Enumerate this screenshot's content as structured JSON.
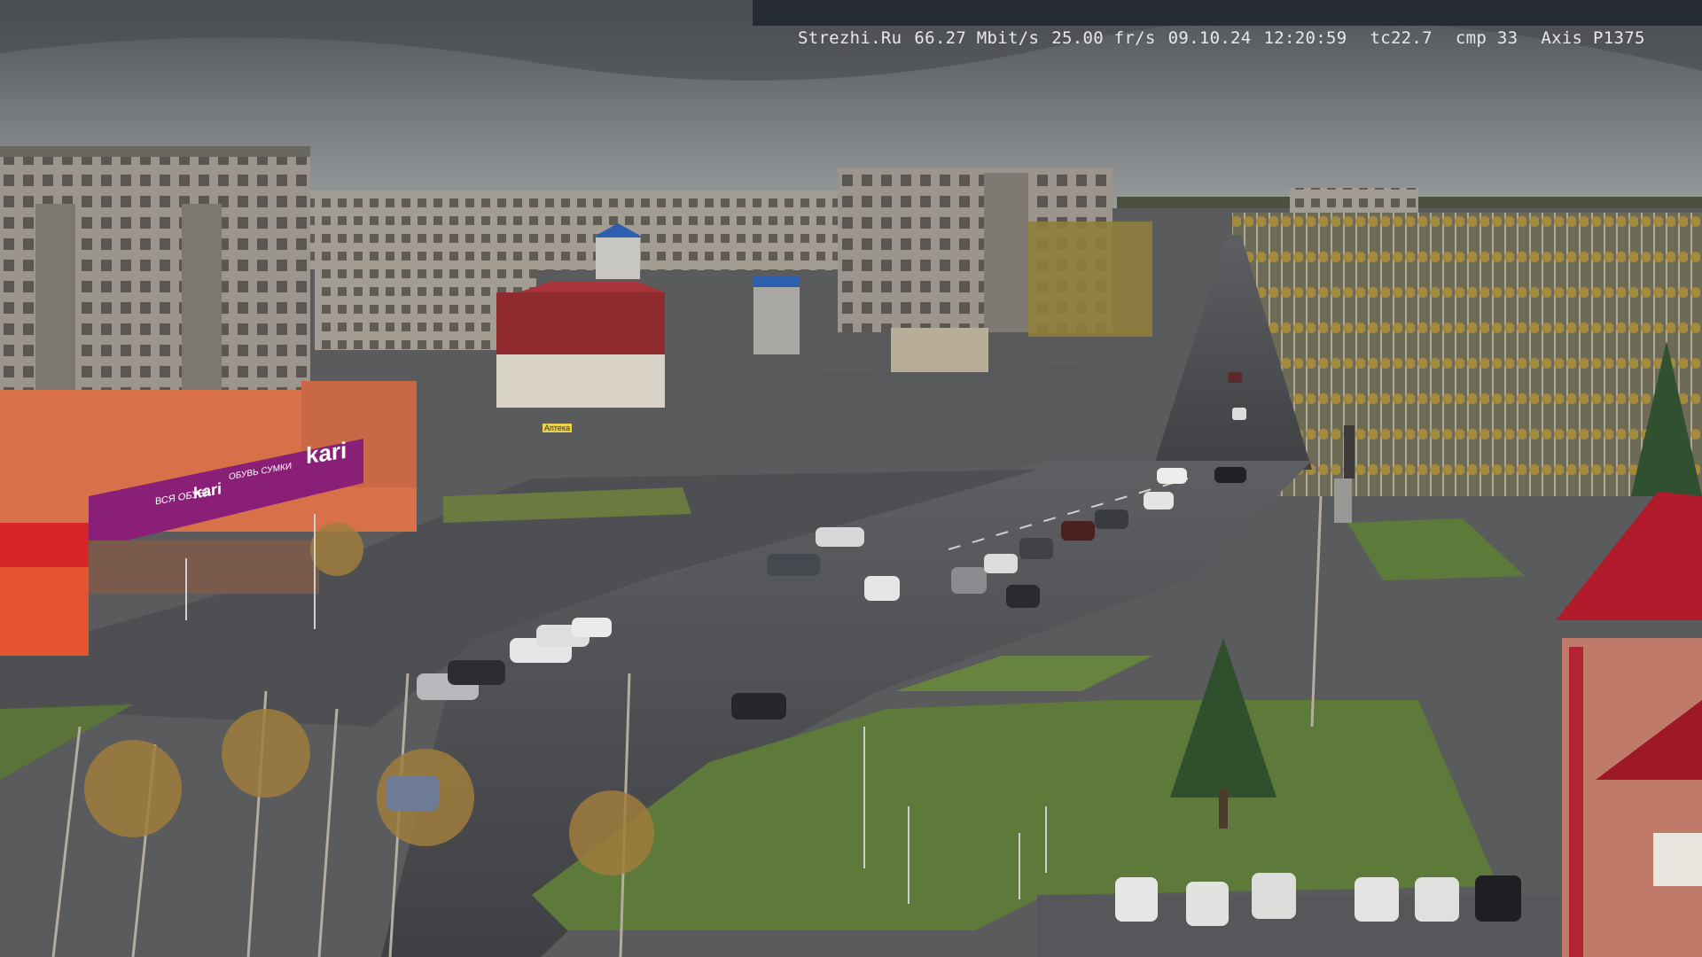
{
  "overlay": {
    "site": "Strezhi.Ru",
    "bitrate": "66.27 Mbit/s",
    "framerate": "25.00 fr/s",
    "date": "09.10.24",
    "time": "12:20:59",
    "tc": "tc22.7",
    "cmp": "cmp 33",
    "camera": "Axis P1375"
  },
  "signs": {
    "store_main": "kari",
    "store_sub": "ВСЯ ОБУВЬ",
    "store_sub2": "ОБУВЬ СУМКИ",
    "store_small": "kari",
    "pharmacy": "Аптека"
  },
  "colors": {
    "sky": "#5f6266",
    "sky_low": "#8a8d90",
    "asphalt": "#4a4c4f",
    "grass": "#5e7a3a",
    "building_grey": "#8e8a84",
    "building_red": "#8f2a2e",
    "store_wall": "#d8714a",
    "store_banner": "#8a1f78",
    "tower_red": "#b11b2c"
  }
}
